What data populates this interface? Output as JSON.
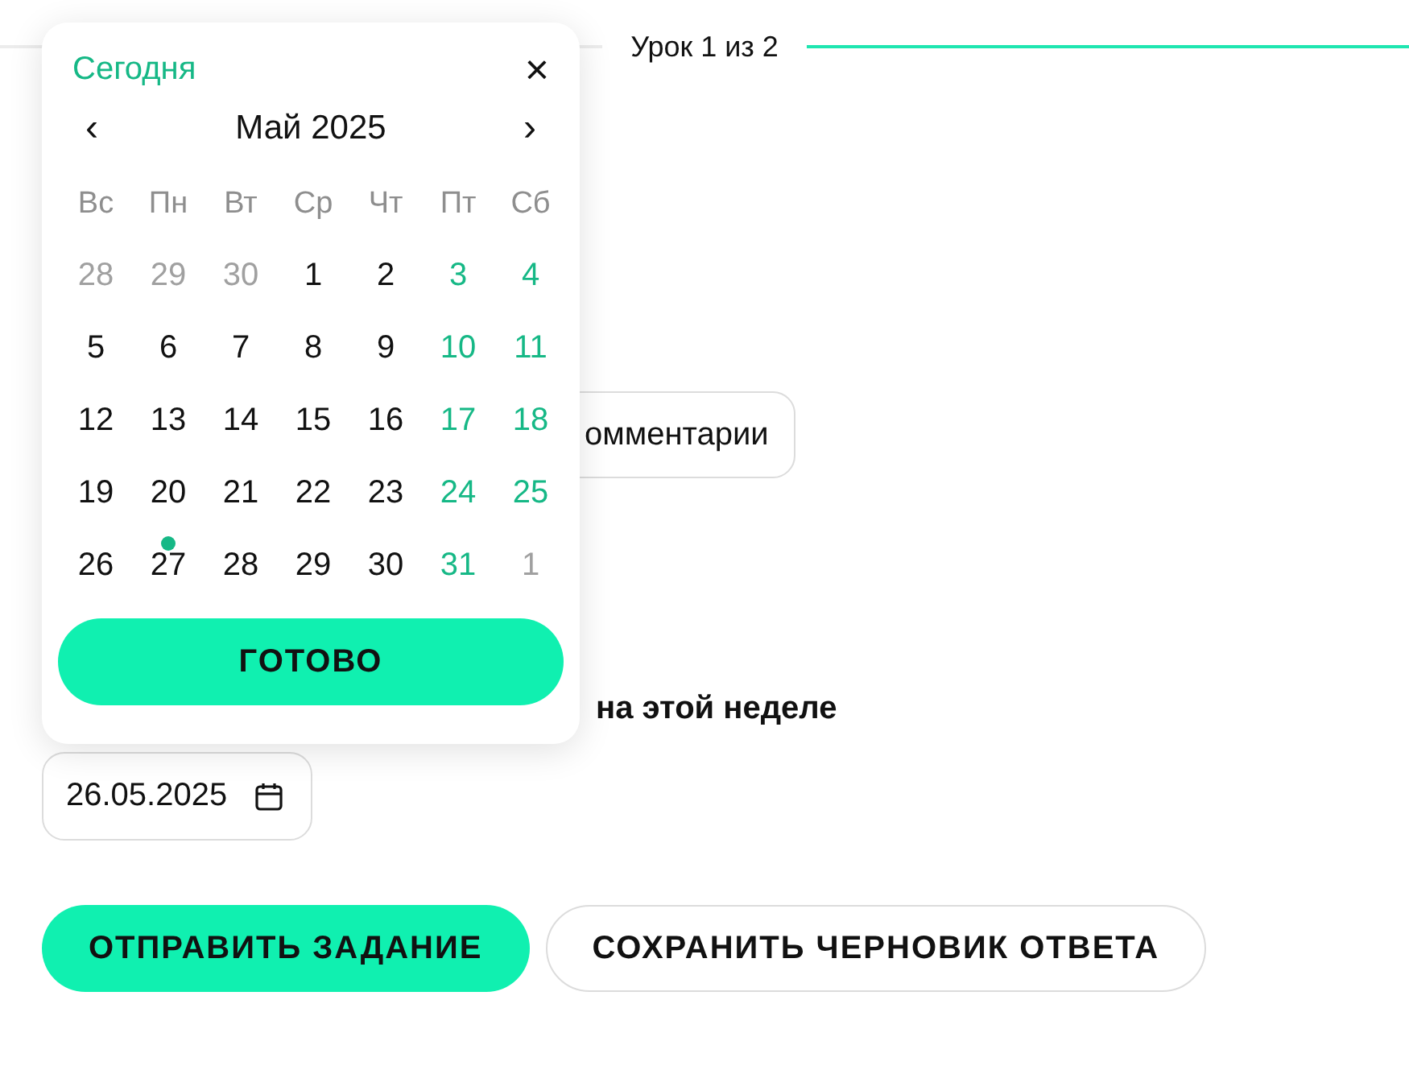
{
  "progress": {
    "label": "Урок 1 из 2"
  },
  "comments_chip": {
    "label": "омментарии"
  },
  "deadline_heading": "на этой неделе",
  "date_field": {
    "value": "26.05.2025"
  },
  "buttons": [
    {
      "label": "ОТПРАВИТЬ ЗАДАНИЕ",
      "kind": "primary"
    },
    {
      "label": "СОХРАНИТЬ ЧЕРНОВИК ОТВЕТА",
      "kind": "secondary"
    }
  ],
  "calendar": {
    "today_link": "Сегодня",
    "close": "×",
    "prev": "‹",
    "next": "›",
    "month": "Май 2025",
    "weekdays": [
      "Вс",
      "Пн",
      "Вт",
      "Ср",
      "Чт",
      "Пт",
      "Сб"
    ],
    "days": [
      {
        "label": "28",
        "kind": "other",
        "today": false
      },
      {
        "label": "29",
        "kind": "other",
        "today": false
      },
      {
        "label": "30",
        "kind": "other",
        "today": false
      },
      {
        "label": "1",
        "kind": "workday",
        "today": false
      },
      {
        "label": "2",
        "kind": "workday",
        "today": false
      },
      {
        "label": "3",
        "kind": "weekend",
        "today": false
      },
      {
        "label": "4",
        "kind": "weekend",
        "today": false
      },
      {
        "label": "5",
        "kind": "workday",
        "today": false
      },
      {
        "label": "6",
        "kind": "workday",
        "today": false
      },
      {
        "label": "7",
        "kind": "workday",
        "today": false
      },
      {
        "label": "8",
        "kind": "workday",
        "today": false
      },
      {
        "label": "9",
        "kind": "workday",
        "today": false
      },
      {
        "label": "10",
        "kind": "weekend",
        "today": false
      },
      {
        "label": "11",
        "kind": "weekend",
        "today": false
      },
      {
        "label": "12",
        "kind": "workday",
        "today": false
      },
      {
        "label": "13",
        "kind": "workday",
        "today": false
      },
      {
        "label": "14",
        "kind": "workday",
        "today": false
      },
      {
        "label": "15",
        "kind": "workday",
        "today": false
      },
      {
        "label": "16",
        "kind": "workday",
        "today": false
      },
      {
        "label": "17",
        "kind": "weekend",
        "today": false
      },
      {
        "label": "18",
        "kind": "weekend",
        "today": false
      },
      {
        "label": "19",
        "kind": "workday",
        "today": false
      },
      {
        "label": "20",
        "kind": "workday",
        "today": false
      },
      {
        "label": "21",
        "kind": "workday",
        "today": false
      },
      {
        "label": "22",
        "kind": "workday",
        "today": false
      },
      {
        "label": "23",
        "kind": "workday",
        "today": false
      },
      {
        "label": "24",
        "kind": "weekend",
        "today": false
      },
      {
        "label": "25",
        "kind": "weekend",
        "today": false
      },
      {
        "label": "26",
        "kind": "workday",
        "today": false
      },
      {
        "label": "27",
        "kind": "workday",
        "today": true
      },
      {
        "label": "28",
        "kind": "workday",
        "today": false
      },
      {
        "label": "29",
        "kind": "workday",
        "today": false
      },
      {
        "label": "30",
        "kind": "workday",
        "today": false
      },
      {
        "label": "31",
        "kind": "weekend",
        "today": false
      },
      {
        "label": "1",
        "kind": "other",
        "today": false
      }
    ],
    "done_button": "ГОТОВО"
  }
}
